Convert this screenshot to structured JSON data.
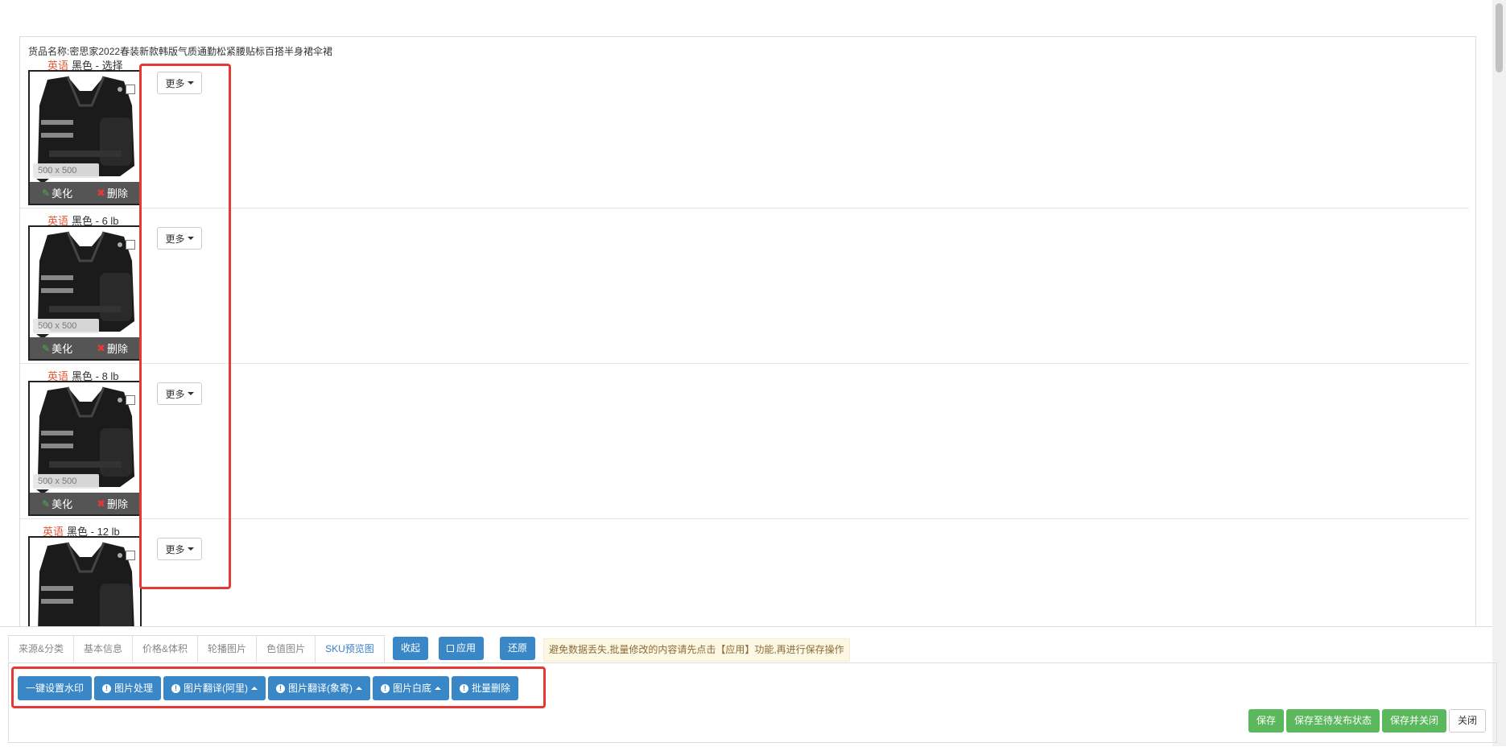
{
  "product": {
    "label": "货品名称:",
    "name": "密思家2022春装新款韩版气质通勤松紧腰贴标百搭半身裙伞裙"
  },
  "sku_rows": [
    {
      "lang": "英语",
      "variant": "黑色 - 选择",
      "dims": "500 x 500",
      "beautify": "美化",
      "delete": "删除",
      "more": "更多"
    },
    {
      "lang": "英语",
      "variant": "黑色 - 6 lb",
      "dims": "500 x 500",
      "beautify": "美化",
      "delete": "删除",
      "more": "更多"
    },
    {
      "lang": "英语",
      "variant": "黑色 - 8 lb",
      "dims": "500 x 500",
      "beautify": "美化",
      "delete": "删除",
      "more": "更多"
    },
    {
      "lang": "英语",
      "variant": "黑色 - 12 lb",
      "more": "更多"
    }
  ],
  "tabs": [
    {
      "label": "来源&分类",
      "active": false
    },
    {
      "label": "基本信息",
      "active": false
    },
    {
      "label": "价格&体积",
      "active": false
    },
    {
      "label": "轮播图片",
      "active": false
    },
    {
      "label": "色值图片",
      "active": false
    },
    {
      "label": "SKU预览图",
      "active": true
    }
  ],
  "tab_actions": {
    "collapse": "收起",
    "apply": "应用",
    "restore": "还原"
  },
  "notice": "避免数据丢失,批量修改的内容请先点击【应用】功能,再进行保存操作",
  "image_actions": {
    "watermark": "一键设置水印",
    "process": "图片处理",
    "translate_ali": "图片翻译(阿里)",
    "translate_xiang": "图片翻译(象寄)",
    "white_bg": "图片白底",
    "batch_delete": "批量删除"
  },
  "save_actions": {
    "save": "保存",
    "save_pending": "保存至待发布状态",
    "save_close": "保存并关闭",
    "close": "关闭"
  },
  "colors": {
    "primary": "#3a87c8",
    "success": "#5cb85c",
    "highlight": "#e53935",
    "language": "#e05a3a"
  }
}
